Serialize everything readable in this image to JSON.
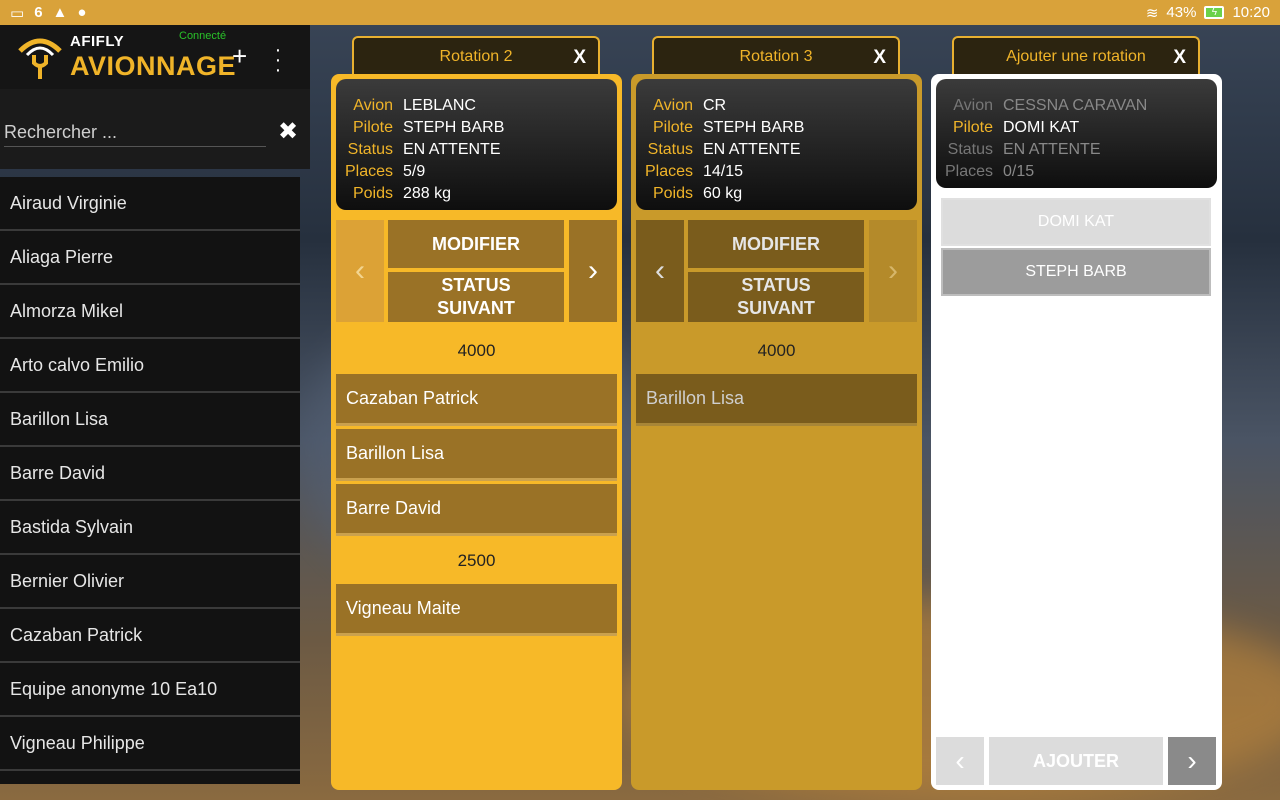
{
  "status_bar": {
    "notif_icons": [
      "image-icon",
      "6",
      "warning-icon",
      "pin-icon"
    ],
    "six": "6",
    "battery_pct": "43%",
    "time": "10:20"
  },
  "app": {
    "brand_small": "AFIFLY",
    "brand_big": "AVIONNAGE",
    "connection": "Connecté",
    "accent": "#f0b429"
  },
  "search": {
    "placeholder": "Rechercher ...",
    "value": ""
  },
  "people": [
    "Airaud Virginie",
    "Aliaga Pierre",
    "Almorza Mikel",
    "Arto calvo Emilio",
    "Barillon Lisa",
    "Barre David",
    "Bastida Sylvain",
    "Bernier Olivier",
    "Cazaban Patrick",
    "Equipe anonyme 10 Ea10",
    "Vigneau Philippe"
  ],
  "labels": {
    "avion": "Avion",
    "pilote": "Pilote",
    "status": "Status",
    "places": "Places",
    "poids": "Poids",
    "close": "X",
    "modifier": "MODIFIER",
    "status_suivant_1": "STATUS",
    "status_suivant_2": "SUIVANT"
  },
  "rotation2": {
    "tab": "Rotation 2",
    "avion": "LEBLANC",
    "pilote": "STEPH BARB",
    "status": "EN ATTENTE",
    "places": "5/9",
    "poids": "288 kg",
    "altitude_1": "4000",
    "pax_1": [
      "Cazaban Patrick",
      "Barillon Lisa",
      "Barre David"
    ],
    "altitude_2": "2500",
    "pax_2": [
      "Vigneau Maite"
    ]
  },
  "rotation3": {
    "tab": "Rotation 3",
    "avion": "CR",
    "pilote": "STEPH BARB",
    "status": "EN ATTENTE",
    "places": "14/15",
    "poids": "60 kg",
    "altitude_1": "4000",
    "pax_1": [
      "Barillon Lisa"
    ]
  },
  "new_rotation": {
    "tab": "Ajouter une rotation",
    "avion": "CESSNA CARAVAN",
    "pilote": "DOMI KAT",
    "status": "EN ATTENTE",
    "places": "0/15",
    "choices": [
      "DOMI KAT",
      "STEPH BARB"
    ],
    "add_label": "AJOUTER"
  }
}
